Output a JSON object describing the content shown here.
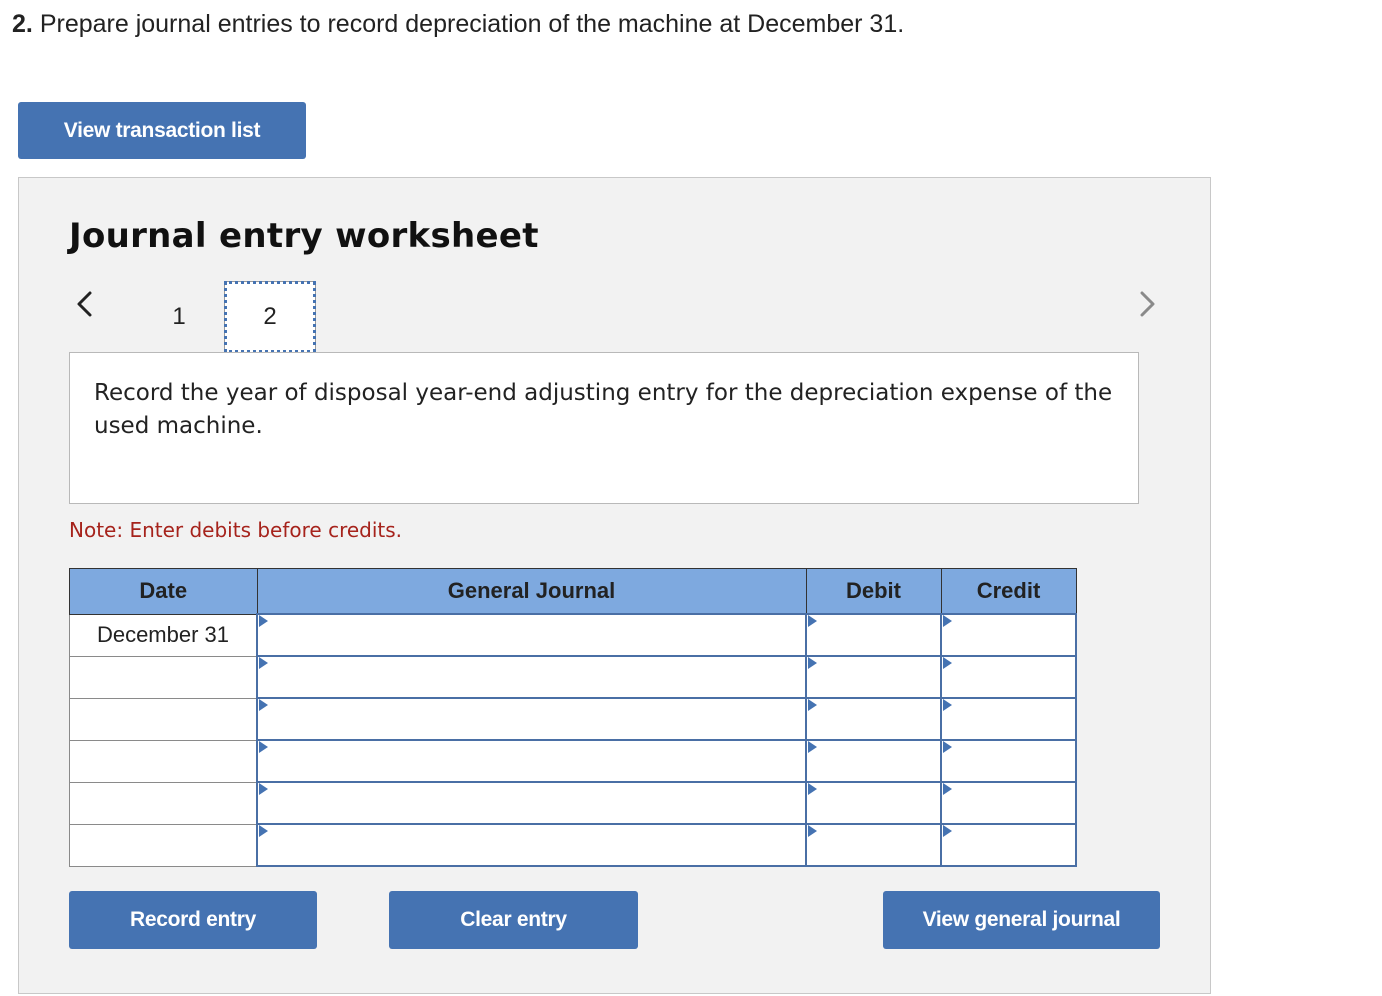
{
  "question": {
    "number": "2.",
    "text": "Prepare journal entries to record depreciation of the machine at December 31."
  },
  "buttons": {
    "view_transaction_list": "View transaction list",
    "record_entry": "Record entry",
    "clear_entry": "Clear entry",
    "view_general_journal": "View general journal"
  },
  "worksheet": {
    "title": "Journal entry worksheet",
    "tabs": [
      {
        "label": "1",
        "active": false
      },
      {
        "label": "2",
        "active": true
      }
    ],
    "description": "Record the year of disposal year-end adjusting entry for the depreciation expense of the used machine.",
    "note": "Note: Enter debits before credits."
  },
  "journal": {
    "headers": {
      "date": "Date",
      "general_journal": "General Journal",
      "debit": "Debit",
      "credit": "Credit"
    },
    "rows": [
      {
        "date": "December 31",
        "account": "",
        "debit": "",
        "credit": ""
      },
      {
        "date": "",
        "account": "",
        "debit": "",
        "credit": ""
      },
      {
        "date": "",
        "account": "",
        "debit": "",
        "credit": ""
      },
      {
        "date": "",
        "account": "",
        "debit": "",
        "credit": ""
      },
      {
        "date": "",
        "account": "",
        "debit": "",
        "credit": ""
      },
      {
        "date": "",
        "account": "",
        "debit": "",
        "credit": ""
      }
    ]
  },
  "colors": {
    "button_blue": "#4573b2",
    "header_blue": "#7ea9df",
    "note_red": "#a6231c"
  }
}
